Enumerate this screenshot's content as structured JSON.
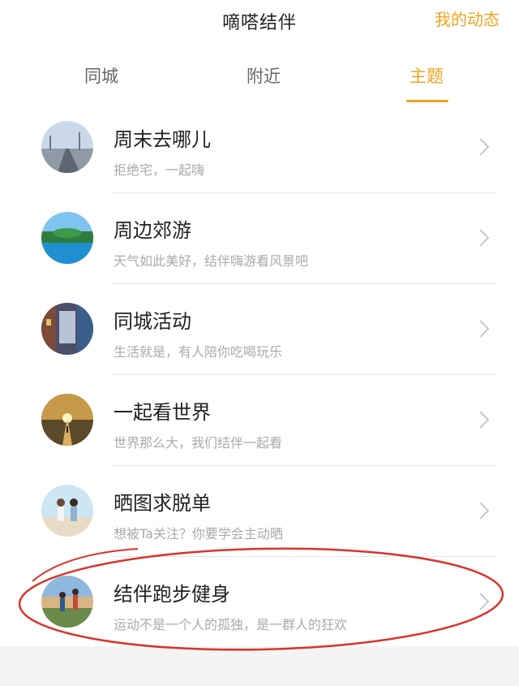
{
  "header": {
    "title": "嘀嗒结伴",
    "action": "我的动态"
  },
  "tabs": [
    {
      "label": "同城",
      "active": false
    },
    {
      "label": "附近",
      "active": false
    },
    {
      "label": "主题",
      "active": true
    }
  ],
  "accent_color": "#f2a31c",
  "topics": [
    {
      "title": "周末去哪儿",
      "subtitle": "拒绝宅，一起嗨",
      "avatar": "road-photo"
    },
    {
      "title": "周边郊游",
      "subtitle": "天气如此美好，结伴嗨游看风景吧",
      "avatar": "lake-photo"
    },
    {
      "title": "同城活动",
      "subtitle": "生活就是，有人陪你吃喝玩乐",
      "avatar": "street-photo"
    },
    {
      "title": "一起看世界",
      "subtitle": "世界那么大，我们结伴一起看",
      "avatar": "sunset-photo"
    },
    {
      "title": "晒图求脱单",
      "subtitle": "想被Ta关注？你要学会主动晒",
      "avatar": "couple-photo"
    },
    {
      "title": "结伴跑步健身",
      "subtitle": "运动不是一个人的孤独，是一群人的狂欢",
      "avatar": "running-photo"
    }
  ],
  "annotation_color": "#d9342b"
}
